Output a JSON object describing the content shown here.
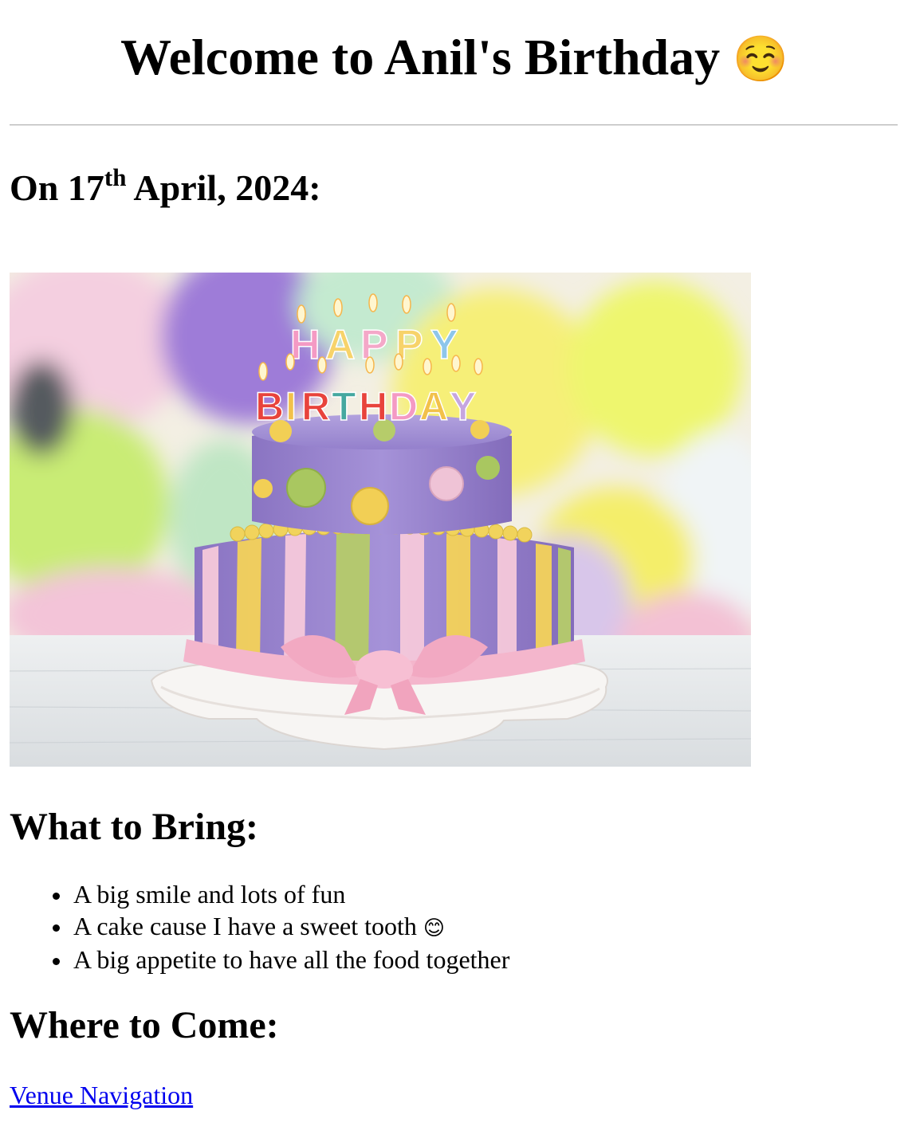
{
  "page": {
    "title": "Welcome to Anil's Birthday",
    "title_emoji": "☺️",
    "date": {
      "prefix": "On 17",
      "suffix_sup": "th",
      "rest": " April, 2024:"
    }
  },
  "hero_image": {
    "caption_text_in_image": [
      "HAPPY",
      "BIRTHDAY"
    ],
    "colors": {
      "cake_purple": "#9b86cf",
      "yellow": "#f4d25a",
      "green": "#b6cc6a",
      "pink": "#f2b8cf"
    }
  },
  "bring_section": {
    "heading": "What to Bring:",
    "items": [
      {
        "text": "A big smile and lots of fun",
        "emoji": ""
      },
      {
        "text": "A cake cause I have a sweet tooth ",
        "emoji": "😊"
      },
      {
        "text": "A big appetite to have all the food together",
        "emoji": ""
      }
    ]
  },
  "where_section": {
    "heading": "Where to Come:",
    "link_label": "Venue Navigation"
  }
}
